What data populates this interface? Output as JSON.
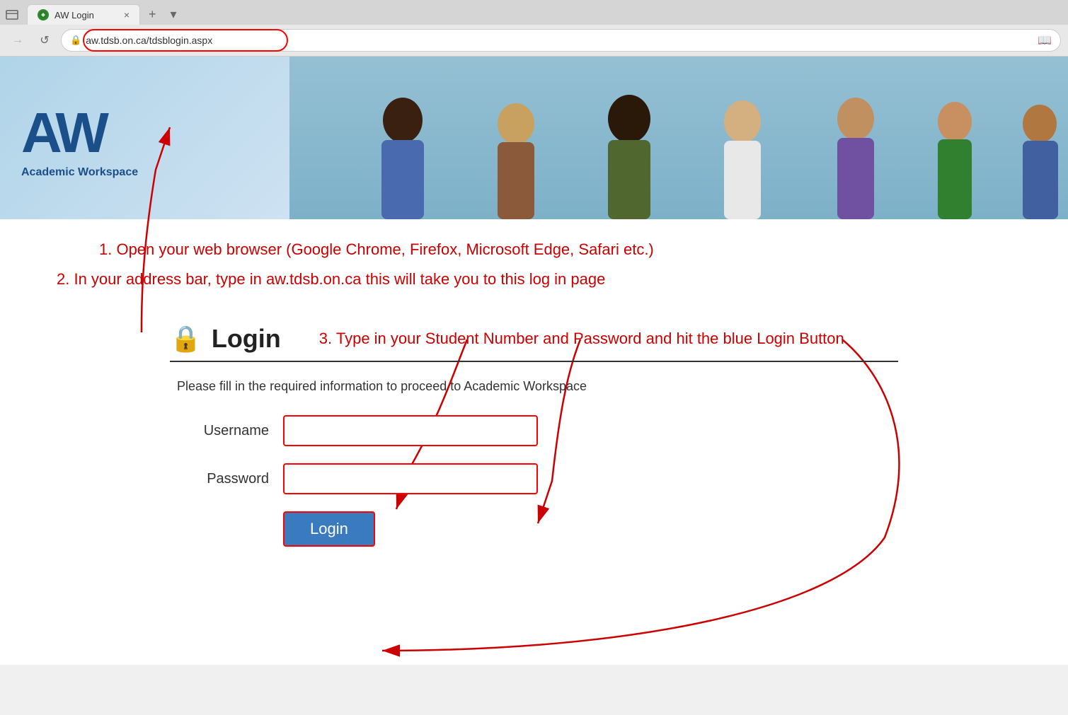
{
  "browser": {
    "tab_title": "AW Login",
    "address": "aw.tdsb.on.ca/tdsblogin.aspx",
    "tab_close_label": "×",
    "tab_new_label": "+",
    "tab_more_label": "▾",
    "back_label": "→",
    "reload_label": "↺"
  },
  "logo": {
    "main": "AW",
    "subtitle": "Academic Workspace"
  },
  "annotations": {
    "step1": "1. Open your web browser (Google Chrome, Firefox, Microsoft Edge, Safari etc.)",
    "step2": "2. In your address bar, type in   aw.tdsb.on.ca   this will take you to this log in page",
    "step3": "3. Type in your Student Number and Password and hit the blue Login Button"
  },
  "login": {
    "icon": "🔒",
    "title": "Login",
    "description": "Please fill in the required information to proceed to Academic Workspace",
    "username_label": "Username",
    "password_label": "Password",
    "button_label": "Login",
    "username_placeholder": "",
    "password_placeholder": ""
  }
}
